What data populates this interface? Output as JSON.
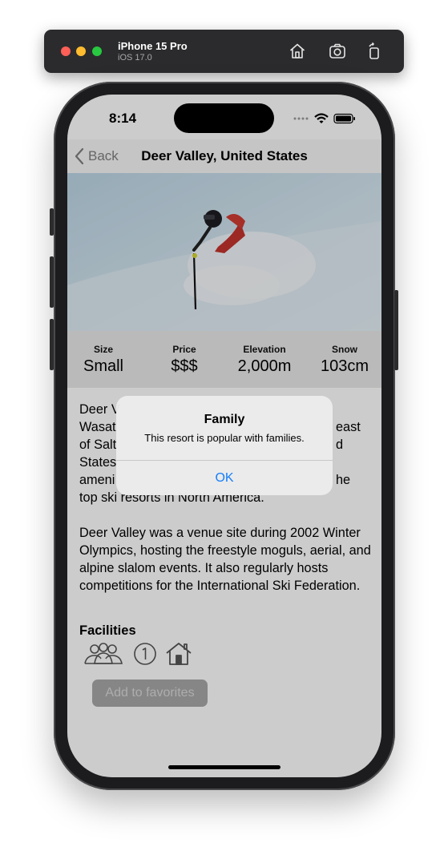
{
  "simulator": {
    "device": "iPhone 15 Pro",
    "os": "iOS 17.0"
  },
  "status_bar": {
    "time": "8:14"
  },
  "nav": {
    "back_label": "Back",
    "title": "Deer Valley, United States"
  },
  "stats": [
    {
      "label": "Size",
      "value": "Small"
    },
    {
      "label": "Price",
      "value": "$$$"
    },
    {
      "label": "Elevation",
      "value": "2,000m"
    },
    {
      "label": "Snow",
      "value": "103cm"
    }
  ],
  "description": {
    "lines_p1": [
      "Deer V",
      "Wasat",
      "of Salt",
      "States",
      "ameni",
      "top ski resorts in North America."
    ],
    "fragments_p1": [
      "east",
      "d",
      "he"
    ],
    "paragraph_2": "Deer Valley was a venue site during 2002 Winter Olympics, hosting the freestyle moguls, aerial, and alpine slalom events. It also regularly hosts competitions for the International Ski Federation."
  },
  "facilities": {
    "title": "Facilities",
    "icons": [
      "family-icon",
      "one-circle-icon",
      "house-icon"
    ]
  },
  "favorites_button": "Add to favorites",
  "alert": {
    "title": "Family",
    "message": "This resort is popular with families.",
    "ok_label": "OK"
  },
  "colors": {
    "accent": "#147efb",
    "alert_bg": "#ebebeb"
  }
}
